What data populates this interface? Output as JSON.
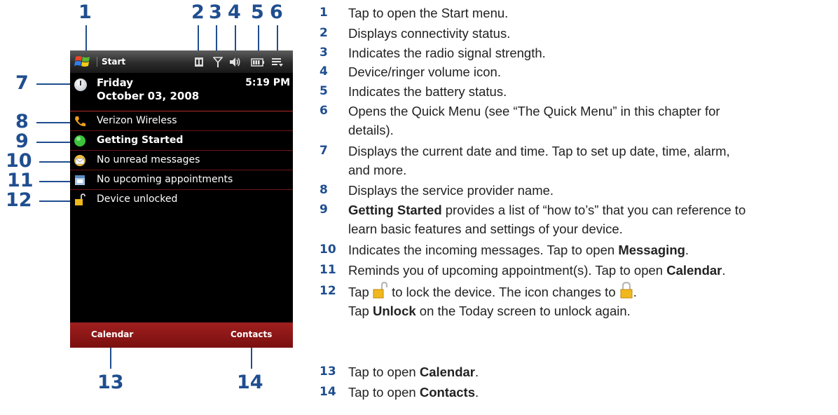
{
  "callouts": [
    "1",
    "2",
    "3",
    "4",
    "5",
    "6",
    "7",
    "8",
    "9",
    "10",
    "11",
    "12",
    "13",
    "14"
  ],
  "phone": {
    "title": "Start",
    "day": "Friday",
    "date": "October 03, 2008",
    "time": "5:19 PM",
    "rows": [
      {
        "label": "Verizon Wireless",
        "icon": "phone-icon"
      },
      {
        "label": "Getting Started",
        "icon": "getting-started-icon"
      },
      {
        "label": "No unread messages",
        "icon": "envelope-icon"
      },
      {
        "label": "No upcoming appointments",
        "icon": "calendar-icon"
      },
      {
        "label": "Device unlocked",
        "icon": "unlocked-padlock-icon"
      }
    ],
    "softkeys": {
      "left": "Calendar",
      "right": "Contacts"
    },
    "status_icons": [
      "connectivity-icon",
      "signal-icon",
      "volume-icon",
      "battery-icon",
      "quick-menu-icon"
    ],
    "colors": {
      "accent_red": "#a01f1f",
      "background": "#000000"
    }
  },
  "descriptions": [
    {
      "num": "1",
      "text": "Tap to open the Start menu."
    },
    {
      "num": "2",
      "text": "Displays connectivity status."
    },
    {
      "num": "3",
      "text": "Indicates the radio signal strength."
    },
    {
      "num": "4",
      "text": "Device/ringer volume icon."
    },
    {
      "num": "5",
      "text": "Indicates the battery status."
    },
    {
      "num": "6",
      "line1": "Opens the Quick Menu (see “The Quick Menu” in this chapter for",
      "line2": "details)."
    },
    {
      "num": "7",
      "line1": "Displays the current date and time. Tap to set up date, time, alarm,",
      "line2": "and more."
    },
    {
      "num": "8",
      "text": "Displays the service provider name."
    },
    {
      "num": "9",
      "bold": "Getting Started",
      "line1": " provides a list of “how to’s” that you can reference to",
      "line2": "learn basic features and settings of your device."
    },
    {
      "num": "10",
      "text": "Indicates the incoming messages. Tap to open ",
      "bold": "Messaging",
      "end": "."
    },
    {
      "num": "11",
      "text": "Reminds you of upcoming appointment(s). Tap to open ",
      "bold": "Calendar",
      "end": "."
    },
    {
      "num": "12",
      "pre": "Tap ",
      "mid": " to lock the device. The icon changes to ",
      "end": ".",
      "line2_pre": "Tap ",
      "line2_bold": "Unlock",
      "line2_end": " on the Today screen to unlock again."
    },
    {
      "num": "13",
      "text": "Tap to open ",
      "bold": "Calendar",
      "end": "."
    },
    {
      "num": "14",
      "text": "Tap to open ",
      "bold": "Contacts",
      "end": "."
    }
  ]
}
